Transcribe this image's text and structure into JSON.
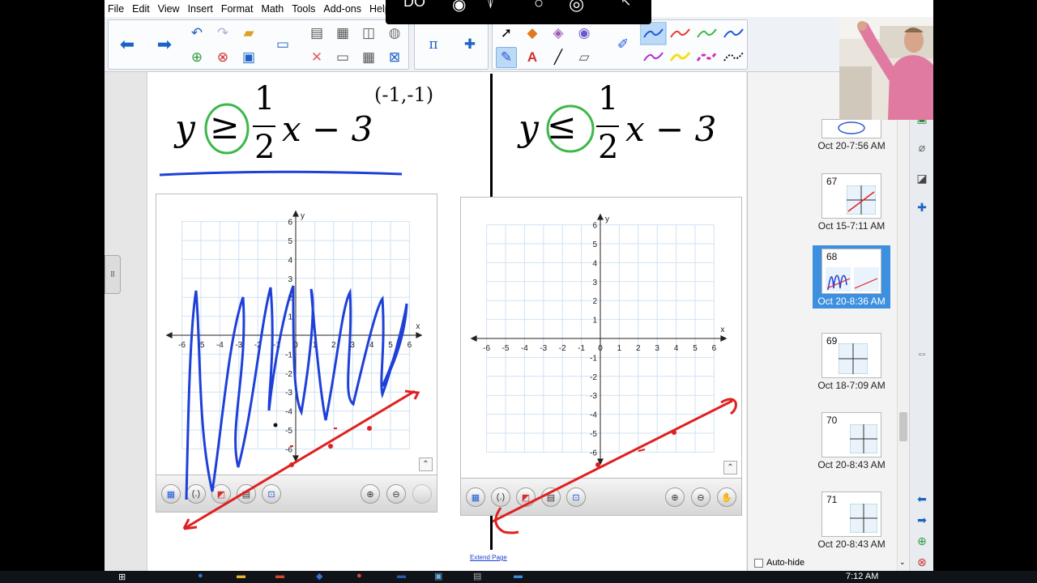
{
  "menu": [
    "File",
    "Edit",
    "View",
    "Insert",
    "Format",
    "Math",
    "Tools",
    "Add-ons",
    "Help"
  ],
  "toolbar": {
    "colors": {
      "pen_blue": "#1e59d8",
      "pen_red": "#e53a2e",
      "pen_green": "#3cb84a",
      "pen_purple": "#b42bd6",
      "pen_yellow": "#f2e11a",
      "pen_magenta": "#d12eb8"
    }
  },
  "left_problem": {
    "lhs": "y",
    "symbol": "≥",
    "numerator": "1",
    "denominator": "2",
    "rhs_tail": "x − 3",
    "annotation": "(-1,-1)"
  },
  "right_problem": {
    "lhs": "y",
    "symbol": "≤",
    "numerator": "1",
    "denominator": "2",
    "rhs_tail": "x − 3"
  },
  "graph": {
    "x_ticks": [
      "-6",
      "-5",
      "-4",
      "-3",
      "-2",
      "-1",
      "0",
      "1",
      "2",
      "3",
      "4",
      "5",
      "6"
    ],
    "y_ticks": [
      "6",
      "5",
      "4",
      "3",
      "2",
      "1",
      "-1",
      "-2",
      "-3",
      "-4",
      "-5",
      "-6"
    ],
    "x_label": "x",
    "y_label": "y",
    "grid_color": "#cfe2f3"
  },
  "extend_page": "Extend Page",
  "sorter": {
    "pages": [
      {
        "num": "",
        "date": "Oct 20-7:56 AM"
      },
      {
        "num": "67",
        "date": "Oct 15-7:11 AM"
      },
      {
        "num": "68",
        "date": "Oct 20-8:36 AM",
        "selected": true
      },
      {
        "num": "69",
        "date": "Oct 18-7:09 AM"
      },
      {
        "num": "70",
        "date": "Oct 20-8:43 AM"
      },
      {
        "num": "71",
        "date": "Oct 20-8:43 AM"
      }
    ],
    "auto_hide": "Auto-hide"
  },
  "recorder": {
    "label": "DO"
  },
  "taskbar": {
    "time": "7:12 AM"
  }
}
